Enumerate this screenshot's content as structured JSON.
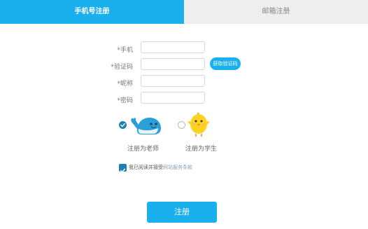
{
  "tabs": [
    {
      "label": "手机号注册",
      "active": true
    },
    {
      "label": "邮箱注册",
      "active": false
    }
  ],
  "form": {
    "phone_label": "*手机",
    "code_label": "*验证码",
    "nickname_label": "*昵称",
    "password_label": "*密码",
    "phone_value": "",
    "code_value": "",
    "nickname_value": "",
    "password_value": "",
    "get_code_button": "获取验证码"
  },
  "roles": [
    {
      "label": "注册为老师",
      "selected": true,
      "icon": "whale-icon"
    },
    {
      "label": "注册为学生",
      "selected": false,
      "icon": "chick-icon"
    }
  ],
  "agreement": {
    "text": "我已阅读并接受",
    "link": "网站服务条款",
    "checked": true
  },
  "submit_label": "注册",
  "colors": {
    "accent": "#1ab0ee",
    "check": "#1f7fb4",
    "tab_inactive": "#eeeeee",
    "whale": "#2a9fd8",
    "chick": "#ffd21f"
  }
}
